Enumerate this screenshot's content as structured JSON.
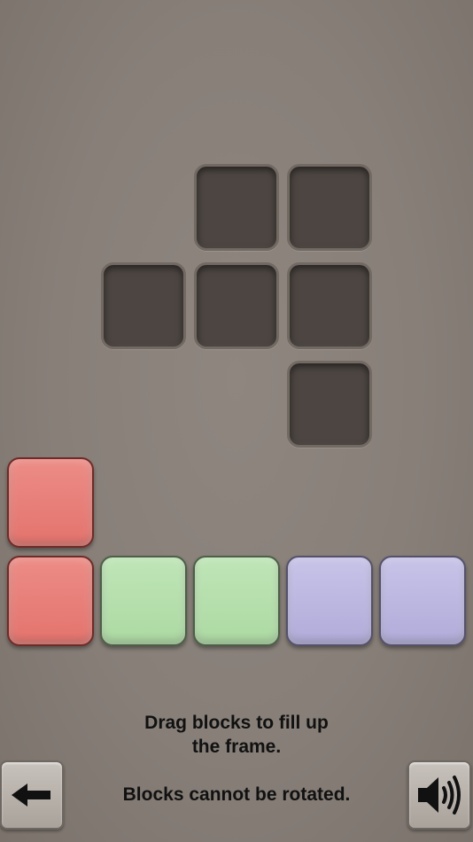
{
  "instructions": {
    "line1": "Drag blocks to fill up",
    "line2": "the frame.",
    "rule": "Blocks cannot be rotated."
  },
  "frame": {
    "cells": [
      [
        0,
        2
      ],
      [
        0,
        3
      ],
      [
        1,
        1
      ],
      [
        1,
        2
      ],
      [
        1,
        3
      ],
      [
        2,
        3
      ]
    ],
    "color": "#4c4541"
  },
  "pieces": [
    {
      "name": "red-piece",
      "color": "#e8807a",
      "cells": [
        [
          0,
          0
        ],
        [
          1,
          0
        ]
      ]
    },
    {
      "name": "green-piece",
      "color": "#b5dfab",
      "cells": [
        [
          1,
          1
        ],
        [
          1,
          2
        ]
      ]
    },
    {
      "name": "purple-piece",
      "color": "#bbb7e0",
      "cells": [
        [
          1,
          3
        ],
        [
          1,
          4
        ]
      ]
    }
  ],
  "controls": {
    "back": "back-arrow-icon",
    "sound": "speaker-icon"
  },
  "colors": {
    "background": "#877f78",
    "text": "#111111"
  }
}
